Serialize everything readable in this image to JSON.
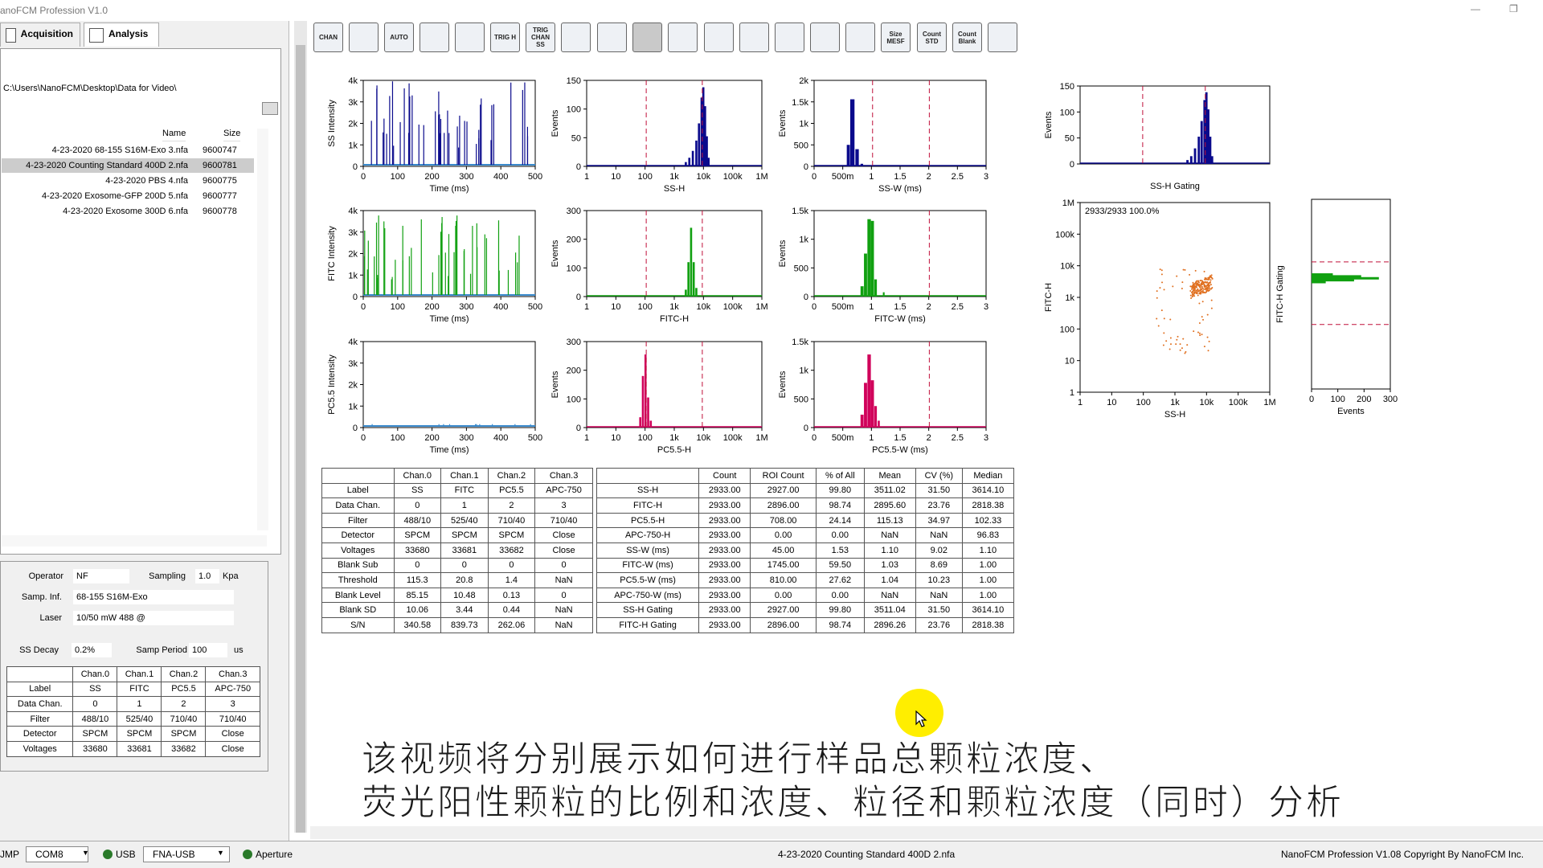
{
  "app": {
    "title": "anoFCM Profession V1.0"
  },
  "tabs": [
    {
      "label": "Acquisition"
    },
    {
      "label": "Analysis"
    }
  ],
  "files": {
    "path": "C:\\Users\\NanoFCM\\Desktop\\Data for Video\\",
    "col_name": "Name",
    "col_size": "Size",
    "rows": [
      {
        "name": "4-23-2020 68-155 S16M-Exo 3.nfa",
        "size": "9600747"
      },
      {
        "name": "4-23-2020 Counting Standard 400D 2.nfa",
        "size": "9600781",
        "selected": true
      },
      {
        "name": "4-23-2020 PBS 4.nfa",
        "size": "9600775"
      },
      {
        "name": "4-23-2020 Exosome-GFP 200D 5.nfa",
        "size": "9600777"
      },
      {
        "name": "4-23-2020 Exosome 300D 6.nfa",
        "size": "9600778"
      }
    ]
  },
  "info": {
    "operator_label": "Operator",
    "operator": "NF",
    "sampling_label": "Sampling",
    "sampling": "1.0",
    "sampling_unit": "Kpa",
    "samp_inf_label": "Samp. Inf.",
    "samp_inf": "68-155 S16M-Exo",
    "laser_label": "Laser",
    "laser": "10/50 mW 488 @",
    "ss_decay_label": "SS Decay",
    "ss_decay": "0.2%",
    "samp_period_label": "Samp Period",
    "samp_period": "100",
    "samp_period_unit": "us"
  },
  "left_table": {
    "header": [
      "",
      "Chan.0",
      "Chan.1",
      "Chan.2",
      "Chan.3"
    ],
    "rows": [
      [
        "Label",
        "SS",
        "FITC",
        "PC5.5",
        "APC-750"
      ],
      [
        "Data Chan.",
        "0",
        "1",
        "2",
        "3"
      ],
      [
        "Filter",
        "488/10",
        "525/40",
        "710/40",
        "710/40"
      ],
      [
        "Detector",
        "SPCM",
        "SPCM",
        "SPCM",
        "Close"
      ],
      [
        "Voltages",
        "33680",
        "33681",
        "33682",
        "Close"
      ]
    ]
  },
  "toolbar": [
    {
      "name": "chan",
      "text": "CHAN"
    },
    {
      "name": "settings",
      "text": ""
    },
    {
      "name": "auto",
      "text": "AUTO"
    },
    {
      "name": "peak",
      "text": ""
    },
    {
      "name": "width",
      "text": ""
    },
    {
      "name": "trig-h",
      "text": "TRIG H"
    },
    {
      "name": "trig-chan-ss",
      "text": "TRIG CHAN SS"
    },
    {
      "name": "save",
      "text": ""
    },
    {
      "name": "camera",
      "text": ""
    },
    {
      "name": "grid",
      "text": ""
    },
    {
      "name": "person",
      "text": ""
    },
    {
      "name": "gate-line",
      "text": ""
    },
    {
      "name": "gate-line-2",
      "text": ""
    },
    {
      "name": "rect-gate",
      "text": ""
    },
    {
      "name": "circle-gate",
      "text": ""
    },
    {
      "name": "polygon-gate",
      "text": ""
    },
    {
      "name": "size-meas",
      "text": "Size MESF"
    },
    {
      "name": "count-std",
      "text": "Count STD"
    },
    {
      "name": "count-blank",
      "text": "Count Blank"
    },
    {
      "name": "report",
      "text": ""
    }
  ],
  "plots": {
    "time_ticks": [
      "0",
      "100",
      "200",
      "300",
      "400",
      "500"
    ],
    "time_label": "Time (ms)",
    "log_ticks": [
      "1",
      "10",
      "100",
      "1k",
      "10k",
      "100k",
      "1M"
    ],
    "w_ticks": [
      "0",
      "500m",
      "1",
      "1.5",
      "2",
      "2.5",
      "3"
    ],
    "ss_time": {
      "ylabel": "SS Intensity",
      "yticks": [
        "0",
        "1k",
        "2k",
        "3k",
        "4k"
      ]
    },
    "fitc_time": {
      "ylabel": "FITC Intensity",
      "yticks": [
        "0",
        "1k",
        "2k",
        "3k",
        "4k"
      ]
    },
    "pc_time": {
      "ylabel": "PC5.5 Intensity",
      "yticks": [
        "0",
        "1k",
        "2k",
        "3k",
        "4k"
      ]
    },
    "ss_h": {
      "xlabel": "SS-H",
      "ylabel": "Events",
      "yticks": [
        "0",
        "50",
        "100",
        "150"
      ]
    },
    "fitc_h": {
      "xlabel": "FITC-H",
      "ylabel": "Events",
      "yticks": [
        "0",
        "100",
        "200",
        "300"
      ]
    },
    "pc_h": {
      "xlabel": "PC5.5-H",
      "ylabel": "Events",
      "yticks": [
        "0",
        "100",
        "200",
        "300"
      ]
    },
    "ss_w": {
      "xlabel": "SS-W (ms)",
      "ylabel": "Events",
      "yticks": [
        "0",
        "500",
        "1k",
        "1.5k",
        "2k"
      ]
    },
    "fitc_w": {
      "xlabel": "FITC-W (ms)",
      "ylabel": "Events",
      "yticks": [
        "0",
        "500",
        "1k",
        "1.5k"
      ]
    },
    "pc_w": {
      "xlabel": "PC5.5-W (ms)",
      "ylabel": "Events",
      "yticks": [
        "0",
        "500",
        "1k",
        "1.5k"
      ]
    },
    "ss_gating": {
      "xlabel": "SS-H Gating",
      "ylabel": "Events",
      "yticks": [
        "0",
        "50",
        "100",
        "150"
      ]
    },
    "scatter": {
      "annotation": "2933/2933  100.0%",
      "xlabel": "SS-H",
      "ylabel": "FITC-H",
      "yticks": [
        "1",
        "10",
        "100",
        "1k",
        "10k",
        "100k",
        "1M"
      ]
    },
    "fitc_gating": {
      "xlabel": "Events",
      "ylabel": "FITC-H Gating",
      "xticks": [
        "0",
        "100",
        "200",
        "300"
      ]
    }
  },
  "chan_table": {
    "header": [
      "",
      "Chan.0",
      "Chan.1",
      "Chan.2",
      "Chan.3"
    ],
    "rows": [
      [
        "Label",
        "SS",
        "FITC",
        "PC5.5",
        "APC-750"
      ],
      [
        "Data Chan.",
        "0",
        "1",
        "2",
        "3"
      ],
      [
        "Filter",
        "488/10",
        "525/40",
        "710/40",
        "710/40"
      ],
      [
        "Detector",
        "SPCM",
        "SPCM",
        "SPCM",
        "Close"
      ],
      [
        "Voltages",
        "33680",
        "33681",
        "33682",
        "Close"
      ],
      [
        "Blank Sub",
        "0",
        "0",
        "0",
        "0"
      ],
      [
        "Threshold",
        "115.3",
        "20.8",
        "1.4",
        "NaN"
      ],
      [
        "Blank Level",
        "85.15",
        "10.48",
        "0.13",
        "0"
      ],
      [
        "Blank SD",
        "10.06",
        "3.44",
        "0.44",
        "NaN"
      ],
      [
        "S/N",
        "340.58",
        "839.73",
        "262.06",
        "NaN"
      ]
    ]
  },
  "stats_table": {
    "header": [
      "",
      "Count",
      "ROI Count",
      "% of All",
      "Mean",
      "CV (%)",
      "Median"
    ],
    "rows": [
      [
        "SS-H",
        "2933.00",
        "2927.00",
        "99.80",
        "3511.02",
        "31.50",
        "3614.10"
      ],
      [
        "FITC-H",
        "2933.00",
        "2896.00",
        "98.74",
        "2895.60",
        "23.76",
        "2818.38"
      ],
      [
        "PC5.5-H",
        "2933.00",
        "708.00",
        "24.14",
        "115.13",
        "34.97",
        "102.33"
      ],
      [
        "APC-750-H",
        "2933.00",
        "0.00",
        "0.00",
        "NaN",
        "NaN",
        "96.83"
      ],
      [
        "SS-W (ms)",
        "2933.00",
        "45.00",
        "1.53",
        "1.10",
        "9.02",
        "1.10"
      ],
      [
        "FITC-W (ms)",
        "2933.00",
        "1745.00",
        "59.50",
        "1.03",
        "8.69",
        "1.00"
      ],
      [
        "PC5.5-W (ms)",
        "2933.00",
        "810.00",
        "27.62",
        "1.04",
        "10.23",
        "1.00"
      ],
      [
        "APC-750-W (ms)",
        "2933.00",
        "0.00",
        "0.00",
        "NaN",
        "NaN",
        "1.00"
      ],
      [
        "SS-H Gating",
        "2933.00",
        "2927.00",
        "99.80",
        "3511.04",
        "31.50",
        "3614.10"
      ],
      [
        "FITC-H Gating",
        "2933.00",
        "2896.00",
        "98.74",
        "2896.26",
        "23.76",
        "2818.38"
      ]
    ]
  },
  "subtitle": {
    "line1": "该视频将分别展示如何进行样品总颗粒浓度、",
    "line2": "荧光阳性颗粒的比例和浓度、粒径和颗粒浓度（同时）分析"
  },
  "status": {
    "jump": "JMP",
    "com": "COM8",
    "usb": "USB",
    "fna": "FNA-USB",
    "aperture": "Aperture",
    "file": "4-23-2020 Counting Standard 400D 2.nfa",
    "copyright": "NanoFCM Profession V1.08 Copyright By  NanoFCM Inc."
  },
  "colors": {
    "ss": "#0a0a8c",
    "fitc": "#10a010",
    "pc": "#d0005a",
    "scatter": "#e07020",
    "gate": "#c0103a",
    "baseline": "#3a8acc"
  }
}
